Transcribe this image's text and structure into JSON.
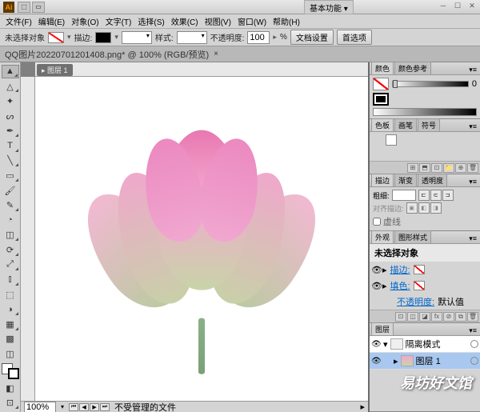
{
  "app": {
    "logo": "Ai",
    "workspace": "基本功能 ▾"
  },
  "menu": [
    "文件(F)",
    "编辑(E)",
    "对象(O)",
    "文字(T)",
    "选择(S)",
    "效果(C)",
    "视图(V)",
    "窗口(W)",
    "帮助(H)"
  ],
  "options": {
    "selection": "未选择对象",
    "fill_label": "填色:",
    "stroke_label": "描边:",
    "stroke_weight": "",
    "style_label": "样式:",
    "opacity_label": "不透明度:",
    "opacity_value": "100",
    "opacity_unit": "%",
    "doc_setup": "文档设置",
    "prefs": "首选项"
  },
  "document": {
    "tab": "QQ图片20220701201408.png* @ 100% (RGB/预览)",
    "layer_tab": "▸ 图层 1"
  },
  "status": {
    "zoom": "100%",
    "label": "不受管理的文件"
  },
  "panels": {
    "color": {
      "tabs": [
        "颜色",
        "颜色参考"
      ],
      "num": "0"
    },
    "swatches": {
      "tabs": [
        "色板",
        "画笔",
        "符号"
      ]
    },
    "stroke": {
      "tabs": [
        "描边",
        "渐变",
        "透明度"
      ],
      "weight_label": "粗细:",
      "weight_value": "",
      "align_label": "对齐描边:",
      "dash_label": "虚线"
    },
    "appearance": {
      "tabs": [
        "外观",
        "图形样式"
      ],
      "title": "未选择对象",
      "stroke_label": "描边:",
      "fill_label": "填色:",
      "opacity_label": "不透明度:",
      "opacity_value": "默认值"
    },
    "layers": {
      "tabs": [
        "图层"
      ],
      "isolation": "隔离模式",
      "layer1": "图层 1"
    }
  },
  "watermark": "易坊好文馆"
}
